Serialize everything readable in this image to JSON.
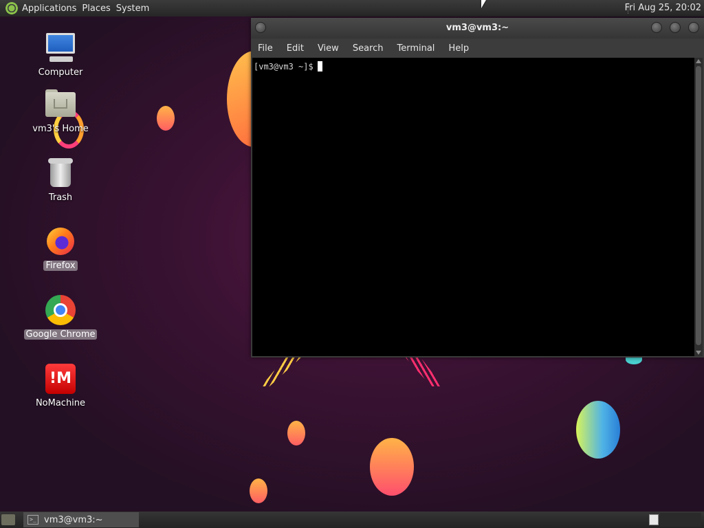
{
  "top_panel": {
    "menus": [
      "Applications",
      "Places",
      "System"
    ],
    "clock": "Fri Aug 25, 20:02"
  },
  "desktop_icons": [
    {
      "label": "Computer",
      "icon": "computer-icon",
      "selected": false
    },
    {
      "label": "vm3's Home",
      "icon": "home-folder-icon",
      "selected": false
    },
    {
      "label": "Trash",
      "icon": "trash-icon",
      "selected": false
    },
    {
      "label": "Firefox",
      "icon": "firefox-icon",
      "selected": true
    },
    {
      "label": "Google Chrome",
      "icon": "chrome-icon",
      "selected": true
    },
    {
      "label": "NoMachine",
      "icon": "nomachine-icon",
      "selected": false
    }
  ],
  "nomachine_logo_text": "!M",
  "terminal": {
    "title": "vm3@vm3:~",
    "menus": [
      "File",
      "Edit",
      "View",
      "Search",
      "Terminal",
      "Help"
    ],
    "prompt": "[vm3@vm3 ~]$"
  },
  "taskbar": {
    "items": [
      {
        "label": "vm3@vm3:~",
        "icon": "terminal-icon"
      }
    ]
  }
}
